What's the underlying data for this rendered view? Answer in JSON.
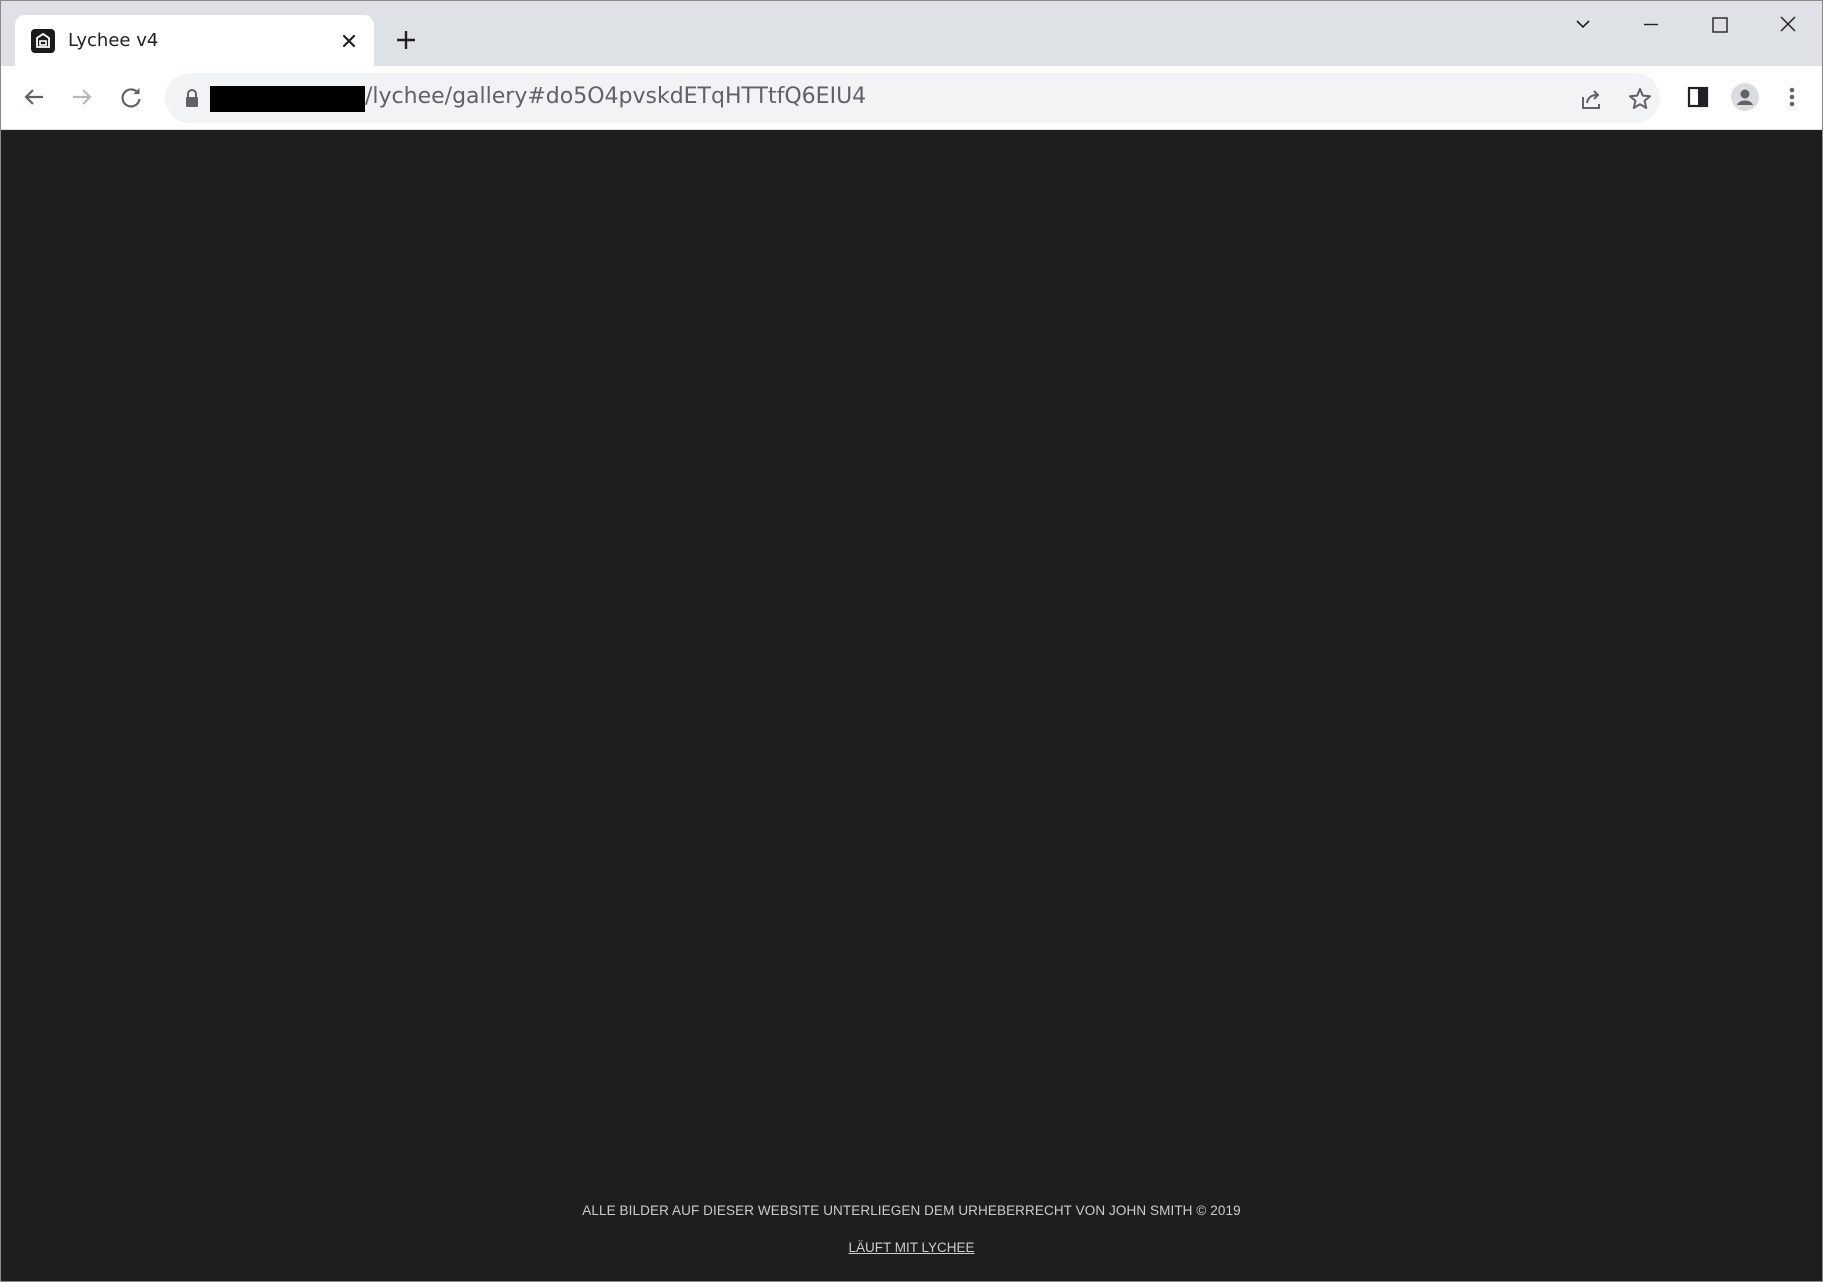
{
  "browser": {
    "tab": {
      "title": "Lychee v4",
      "favicon": "lychee-logo-icon"
    },
    "address_bar": {
      "url_visible": "/lychee/gallery#do5O4pvskdETqHTTtfQ6EIU4",
      "host_redacted": true
    },
    "icons": {
      "back": "arrow-left-icon",
      "forward": "arrow-right-icon",
      "reload": "reload-icon",
      "lock": "lock-icon",
      "share": "share-icon",
      "bookmark": "star-icon",
      "side_panel": "side-panel-icon",
      "profile": "profile-icon",
      "menu": "more-vert-icon",
      "new_tab": "plus-icon",
      "tab_search": "chevron-down-icon",
      "minimize": "minimize-icon",
      "maximize": "maximize-icon",
      "close": "close-icon"
    }
  },
  "page": {
    "background": "#1e1e1e",
    "footer": {
      "copyright": "ALLE BILDER AUF DIESER WEBSITE UNTERLIEGEN DEM URHEBERRECHT VON JOHN SMITH © 2019",
      "powered_by": "LÄUFT MIT LYCHEE"
    }
  }
}
